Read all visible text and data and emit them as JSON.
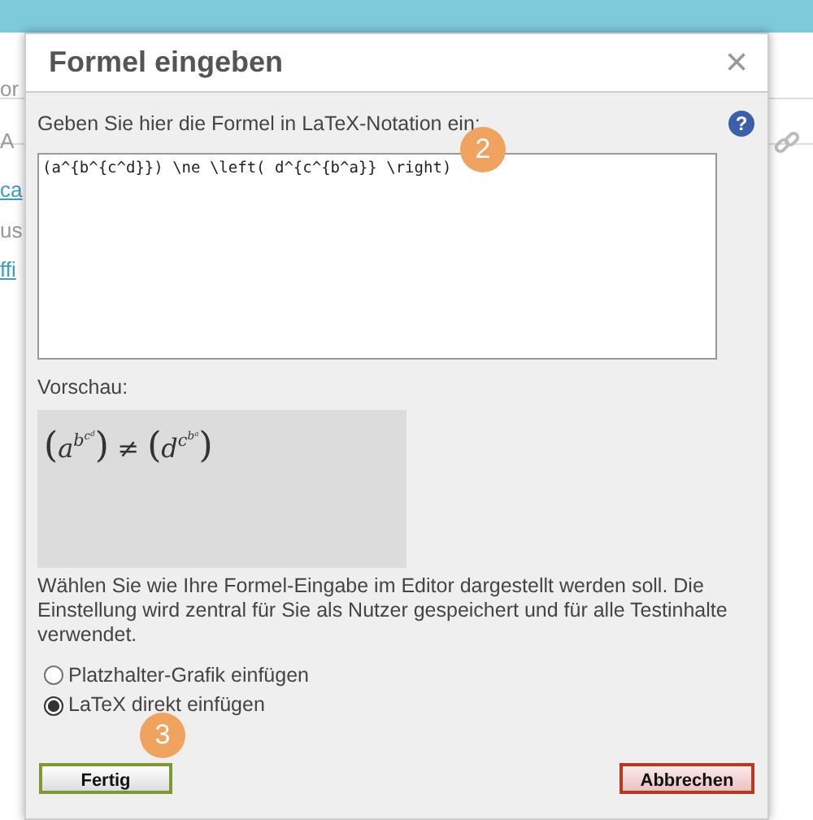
{
  "background": {
    "fragments": [
      {
        "text": "or",
        "kind": "text"
      },
      {
        "text": "A",
        "kind": "text"
      },
      {
        "text": "ca",
        "kind": "link"
      },
      {
        "text": "us",
        "kind": "text"
      },
      {
        "text": "ffi",
        "kind": "link"
      }
    ]
  },
  "dialog": {
    "title": "Formel eingeben",
    "close": "×",
    "help": "?",
    "instruction": "Geben Sie hier die Formel in LaTeX-Notation ein:",
    "formula": "(a^{b^{c^d}}) \\ne \\left( d^{c^{b^a}} \\right)",
    "preview_label": "Vorschau:",
    "preview": {
      "left": {
        "open": "(",
        "powers": [
          "a",
          "b",
          "c",
          "d"
        ],
        "close": ")"
      },
      "relation": "≠",
      "right": {
        "open": "(",
        "powers": [
          "d",
          "c",
          "b",
          "a"
        ],
        "close": ")"
      }
    },
    "description": "Wählen Sie wie Ihre Formel-Eingabe im Editor dargestellt werden soll. Die Einstellung wird zentral für Sie als Nutzer gespeichert und für alle Testinhalte verwendet.",
    "options": [
      {
        "label": "Platzhalter-Grafik einfügen",
        "selected": false
      },
      {
        "label": "LaTeX direkt einfügen",
        "selected": true
      }
    ],
    "buttons": [
      {
        "label": "Fertig",
        "kind": "confirm"
      },
      {
        "label": "Abbrechen",
        "kind": "cancel"
      }
    ],
    "step_badges": [
      {
        "text": "2",
        "kind": "formula"
      },
      {
        "text": "3",
        "kind": "confirm"
      }
    ]
  }
}
